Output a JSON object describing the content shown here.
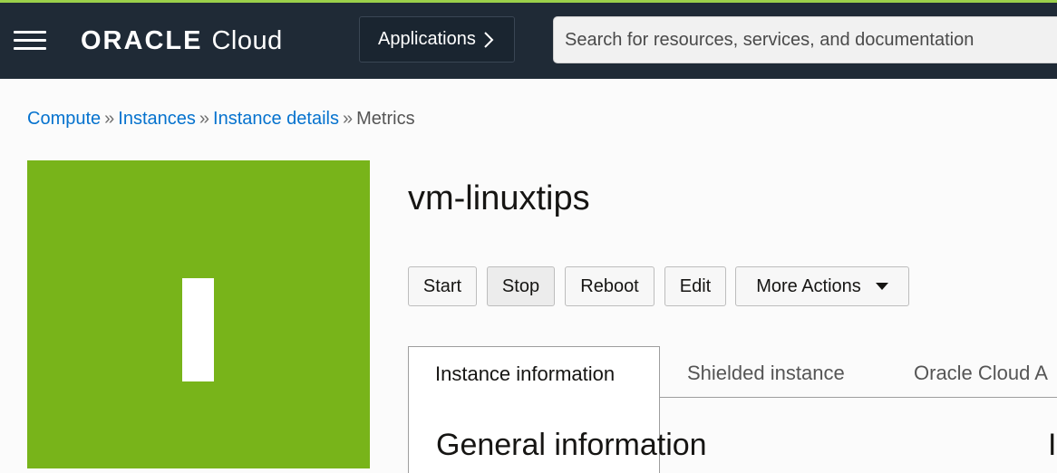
{
  "colors": {
    "accent_line": "#9bd04a",
    "topbar_bg": "#1f2a36",
    "instance_tile": "#78b41a",
    "link": "#0572ce"
  },
  "header": {
    "menu_icon": "hamburger-menu-icon",
    "logo_oracle": "ORACLE",
    "logo_cloud": "Cloud",
    "applications_label": "Applications",
    "applications_icon": "chevron-right-icon",
    "search_placeholder": "Search for resources, services, and documentation"
  },
  "breadcrumb": {
    "items": [
      "Compute",
      "Instances",
      "Instance details"
    ],
    "separator": "»",
    "current": "Metrics"
  },
  "instance": {
    "avatar_letter": "I",
    "name": "vm-linuxtips"
  },
  "actions": {
    "start": "Start",
    "stop": "Stop",
    "reboot": "Reboot",
    "edit": "Edit",
    "more_actions": "More Actions"
  },
  "tabs": {
    "active": "Instance information",
    "others": [
      "Shielded instance",
      "Oracle Cloud A"
    ]
  },
  "content": {
    "section_heading": "General information",
    "cut_heading": "I"
  }
}
